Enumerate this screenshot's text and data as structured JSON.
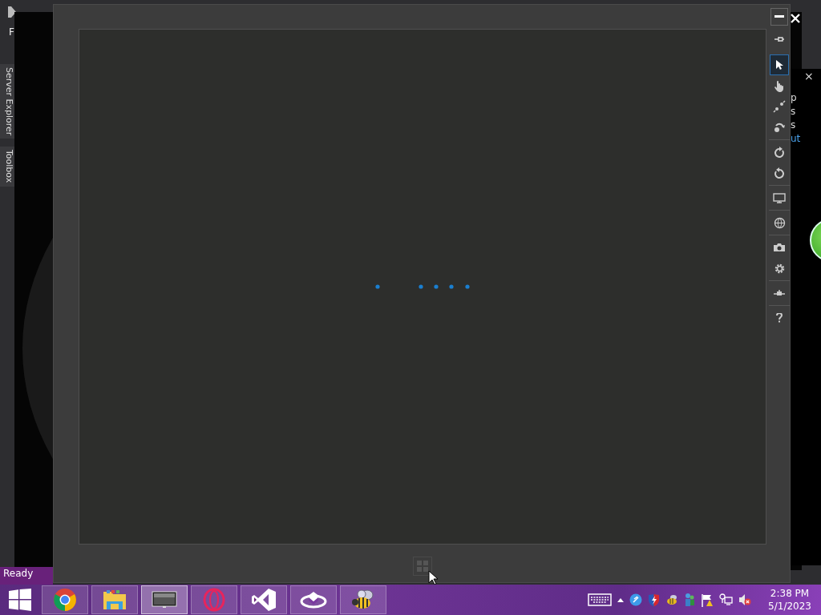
{
  "ide": {
    "menu_initial": "F",
    "side_tabs": [
      "Server Explorer",
      "Toolbox"
    ],
    "panel_close": "×",
    "panel_fragments": [
      "p",
      "s",
      "s",
      "ut"
    ],
    "status": "Ready"
  },
  "emulator": {
    "loading": true,
    "toolbar": [
      {
        "kind": "pin",
        "selected": false
      },
      {
        "kind": "pointer",
        "selected": true
      },
      {
        "kind": "hand",
        "selected": false
      },
      {
        "kind": "pinch",
        "selected": false
      },
      {
        "kind": "rotate-touch",
        "selected": false
      },
      {
        "kind": "separator"
      },
      {
        "kind": "rotate-right",
        "selected": false
      },
      {
        "kind": "rotate-left",
        "selected": false
      },
      {
        "kind": "separator"
      },
      {
        "kind": "monitor",
        "selected": false
      },
      {
        "kind": "separator"
      },
      {
        "kind": "globe",
        "selected": false
      },
      {
        "kind": "separator"
      },
      {
        "kind": "camera",
        "selected": false
      },
      {
        "kind": "gear",
        "selected": false
      },
      {
        "kind": "separator"
      },
      {
        "kind": "network",
        "selected": false
      },
      {
        "kind": "separator"
      },
      {
        "kind": "help",
        "selected": false
      }
    ]
  },
  "taskbar": {
    "apps": [
      {
        "kind": "chrome",
        "selected": false
      },
      {
        "kind": "folder",
        "selected": false
      },
      {
        "kind": "monitor",
        "selected": true
      },
      {
        "kind": "ring",
        "selected": false
      },
      {
        "kind": "studio",
        "selected": false
      },
      {
        "kind": "planet",
        "selected": false
      },
      {
        "kind": "bee",
        "selected": false
      }
    ],
    "tray": [
      {
        "kind": "keyboard"
      },
      {
        "kind": "up-arrow"
      },
      {
        "kind": "blue-circle"
      },
      {
        "kind": "shield"
      },
      {
        "kind": "bee"
      },
      {
        "kind": "people"
      },
      {
        "kind": "flag"
      },
      {
        "kind": "network"
      },
      {
        "kind": "speaker-muted"
      }
    ],
    "time": "2:38 PM",
    "date": "5/1/2023"
  }
}
